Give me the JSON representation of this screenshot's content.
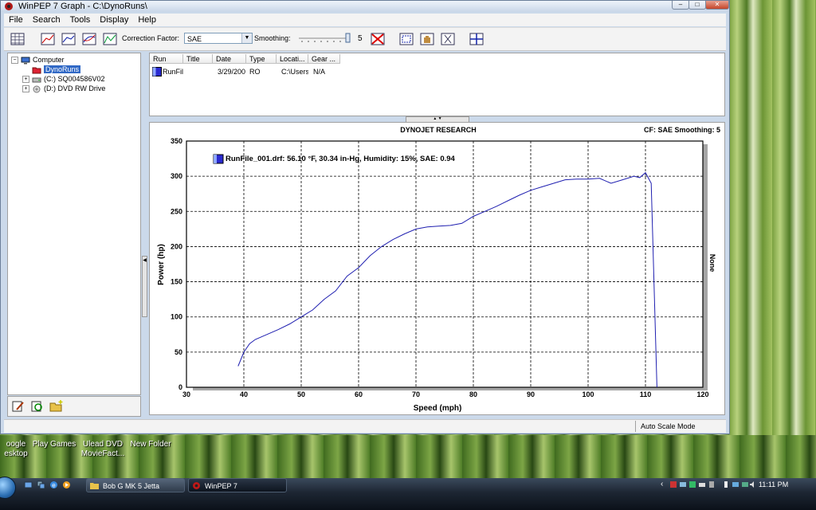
{
  "window": {
    "title": "WinPEP 7    Graph - C:\\DynoRuns\\",
    "min_label": "–",
    "max_label": "□",
    "close_label": "✕"
  },
  "menu": [
    "File",
    "Search",
    "Tools",
    "Display",
    "Help"
  ],
  "toolbar": {
    "correction_label": "Correction Factor:",
    "correction_value": "SAE",
    "smoothing_label": "Smoothing:",
    "smoothing_value": "5"
  },
  "tree": {
    "computer": "Computer",
    "dynoruns": "DynoRuns",
    "drive_c": "(C:) SQ004586V02",
    "drive_d": "(D:) DVD RW Drive"
  },
  "runtable": {
    "headers": [
      "Run",
      "Title",
      "Date",
      "Type",
      "Locati...",
      "Gear ..."
    ],
    "row": {
      "run": "RunFil",
      "title": "",
      "date": "3/29/200",
      "type": "RO",
      "location": "C:\\Users'",
      "gear": "N/A"
    }
  },
  "graph": {
    "header_center": "DYNOJET RESEARCH",
    "header_right": "CF: SAE  Smoothing: 5",
    "legend": "RunFile_001.drf: 56.10 °F, 30.34 in-Hg, Humidity: 15%, SAE: 0.94",
    "right_axis_label": "None",
    "series_color": "#1f1fb0"
  },
  "chart_data": {
    "type": "line",
    "xlabel": "Speed (mph)",
    "ylabel": "Power (hp)",
    "xlim": [
      30,
      120
    ],
    "ylim": [
      0,
      350
    ],
    "xticks": [
      30,
      40,
      50,
      60,
      70,
      80,
      90,
      100,
      110,
      120
    ],
    "yticks": [
      0,
      50,
      100,
      150,
      200,
      250,
      300,
      350
    ],
    "grid": true,
    "legend_position": "top-left",
    "series": [
      {
        "name": "RunFile_001.drf",
        "x": [
          39,
          40,
          41,
          42,
          44,
          46,
          48,
          50,
          52,
          54,
          56,
          58,
          60,
          62,
          64,
          66,
          68,
          70,
          72,
          74,
          76,
          78,
          80,
          82,
          84,
          86,
          88,
          90,
          92,
          94,
          96,
          98,
          100,
          102,
          104,
          106,
          108,
          109,
          110,
          111,
          112
        ],
        "y": [
          30,
          50,
          62,
          68,
          75,
          82,
          90,
          100,
          110,
          125,
          137,
          158,
          170,
          187,
          200,
          210,
          218,
          225,
          228,
          229,
          230,
          233,
          243,
          250,
          257,
          265,
          273,
          280,
          285,
          290,
          295,
          296,
          296,
          297,
          290,
          295,
          300,
          298,
          305,
          290,
          0
        ]
      }
    ]
  },
  "status": {
    "mode": "Auto Scale Mode"
  },
  "desktop": {
    "icon1_line1": "oogle",
    "icon1_line2": "esktop",
    "icon2": "Play Games",
    "icon3_line1": "Ulead DVD",
    "icon3_line2": "MovieFact...",
    "icon4": "New Folder"
  },
  "taskbar": {
    "task1": "Bob G MK 5 Jetta",
    "task2": "WinPEP 7",
    "clock": "11:11 PM"
  }
}
